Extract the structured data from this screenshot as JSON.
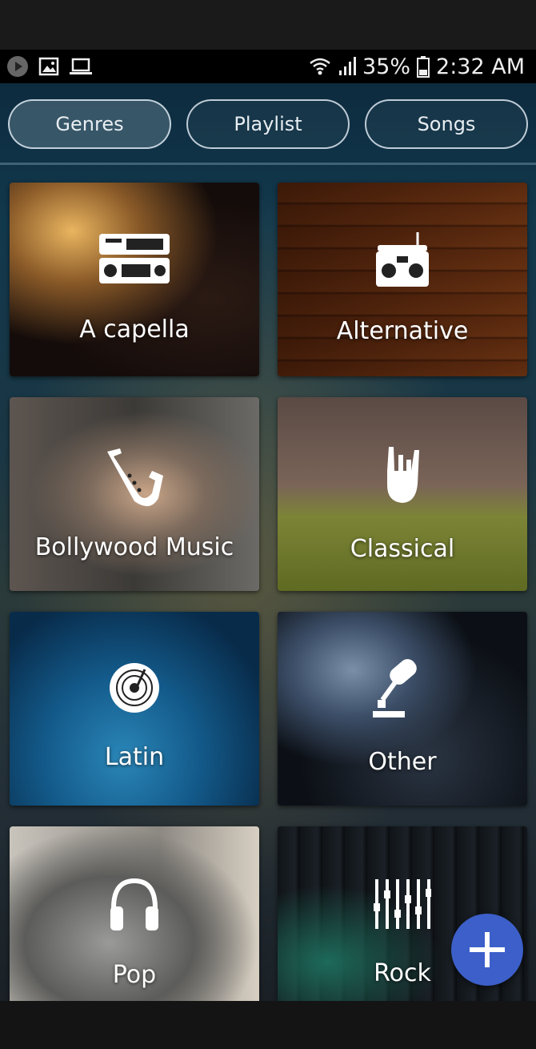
{
  "status_bar": {
    "battery": "35%",
    "time": "2:32 AM",
    "left_icons": [
      "play-circle-icon",
      "image-icon",
      "laptop-icon"
    ],
    "right_icons": [
      "wifi-icon",
      "signal-icon",
      "battery-icon"
    ]
  },
  "tabs": [
    {
      "label": "Genres",
      "active": true
    },
    {
      "label": "Playlist",
      "active": false
    },
    {
      "label": "Songs",
      "active": false
    }
  ],
  "genres": [
    {
      "label": "A capella",
      "icon": "stereo-icon"
    },
    {
      "label": "Alternative",
      "icon": "boombox-icon"
    },
    {
      "label": "Bollywood Music",
      "icon": "saxophone-icon"
    },
    {
      "label": "Classical",
      "icon": "rock-hand-icon"
    },
    {
      "label": "Latin",
      "icon": "vinyl-disc-icon"
    },
    {
      "label": "Other",
      "icon": "microphone-icon"
    },
    {
      "label": "Pop",
      "icon": "headphones-icon"
    },
    {
      "label": "Rock",
      "icon": "equalizer-icon"
    }
  ],
  "fab": {
    "icon": "plus-icon"
  },
  "colors": {
    "accent": "#3c5fc9",
    "status_bar": "#000000"
  }
}
